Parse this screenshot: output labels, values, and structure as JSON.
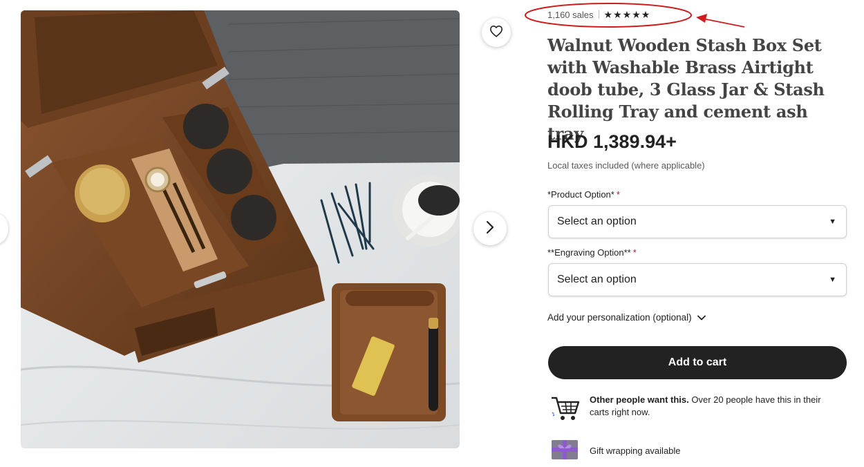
{
  "listing": {
    "sales": "1,160 sales",
    "stars": [
      "★",
      "★",
      "★",
      "★",
      "★"
    ],
    "title": "Walnut Wooden Stash Box Set with Washable Brass Airtight doob tube, 3 Glass Jar & Stash Rolling Tray and cement ash tray",
    "price": "HKD 1,389.94+",
    "tax_note": "Local taxes included (where applicable)"
  },
  "options": [
    {
      "label": "*Product Option*",
      "required_mark": "*",
      "value": "Select an option"
    },
    {
      "label": "**Engraving Option**",
      "required_mark": "*",
      "value": "Select an option"
    }
  ],
  "personalization": {
    "label": "Add your personalization (optional)"
  },
  "actions": {
    "add_to_cart": "Add to cart"
  },
  "perks": {
    "demand_bold": "Other people want this.",
    "demand_rest": " Over 20 people have this in their carts right now.",
    "gift": "Gift wrapping available"
  },
  "icons": {
    "favorite": "heart-icon",
    "next": "chevron-right-icon",
    "dropdown": "caret-down-icon",
    "expand": "chevron-down-icon",
    "cart": "shopping-cart-icon",
    "gift": "gift-icon"
  },
  "colors": {
    "cta": "#222222",
    "required": "#a61a2e",
    "annotation": "#d01c1c"
  }
}
